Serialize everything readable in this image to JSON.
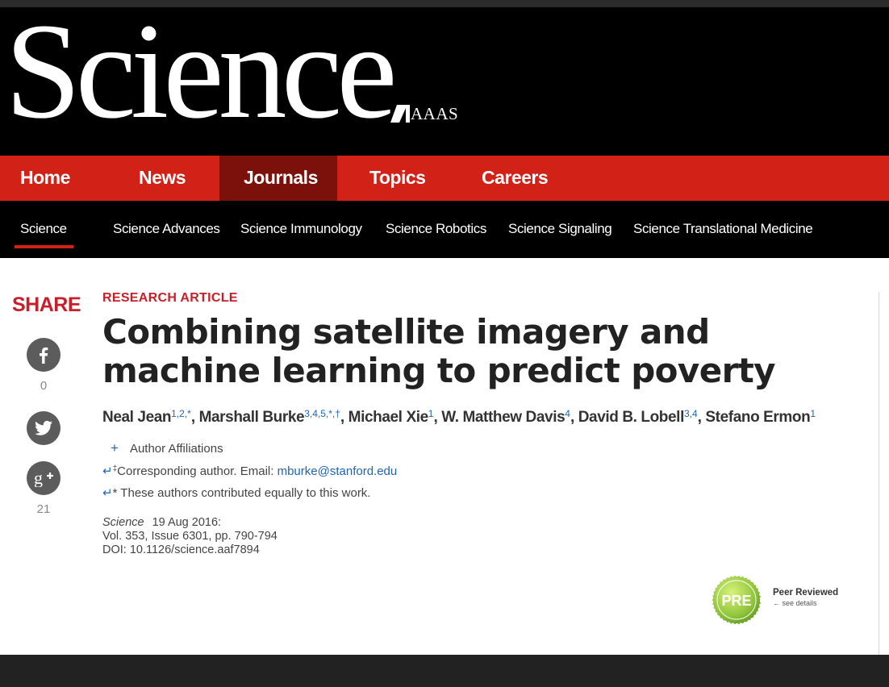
{
  "header": {
    "logo_text": "Science",
    "publisher": "AAAS"
  },
  "main_nav": [
    {
      "label": "Home",
      "active": false
    },
    {
      "label": "News",
      "active": false
    },
    {
      "label": "Journals",
      "active": true
    },
    {
      "label": "Topics",
      "active": false
    },
    {
      "label": "Careers",
      "active": false
    }
  ],
  "sub_nav": [
    {
      "label": "Science",
      "active": true
    },
    {
      "label": "Science Advances"
    },
    {
      "label": "Science Immunology"
    },
    {
      "label": "Science Robotics"
    },
    {
      "label": "Science Signaling"
    },
    {
      "label": "Science Translational Medicine"
    }
  ],
  "share": {
    "title": "SHARE",
    "facebook_count": "0",
    "twitter_count": "",
    "google_count": "21",
    "icons": [
      "facebook-icon",
      "twitter-icon",
      "google-plus-icon"
    ]
  },
  "article": {
    "kicker": "RESEARCH ARTICLE",
    "title": "Combining satellite imagery and machine learning to predict poverty",
    "authors": [
      {
        "name": "Neal Jean",
        "marks": "1,2,*"
      },
      {
        "name": "Marshall Burke",
        "marks": "3,4,5,*,†"
      },
      {
        "name": "Michael Xie",
        "marks": "1"
      },
      {
        "name": "W. Matthew Davis",
        "marks": "4"
      },
      {
        "name": "David B. Lobell",
        "marks": "3,4"
      },
      {
        "name": "Stefano Ermon",
        "marks": "1"
      }
    ],
    "author_affiliations_toggle": "+",
    "author_affiliations_label": "Author Affiliations",
    "return_arrow": "↵",
    "corresponding_mark": "‡",
    "corresponding_text": "Corresponding author. Email: ",
    "corresponding_email": "mburke@stanford.edu",
    "equal_contrib_text": "* These authors contributed equally to this work.",
    "journal": "Science",
    "date": "19 Aug 2016:",
    "volume": "Vol. 353, Issue 6301, pp. 790-794",
    "doi": "DOI: 10.1126/science.aaf7894"
  },
  "badge": {
    "logo_text": "PRE",
    "title": "Peer Reviewed",
    "subtitle": "← see details"
  },
  "colors": {
    "brand_red": "#d22218",
    "active_nav": "#7b110a",
    "link_blue": "#2164b5",
    "masthead": "#000000"
  }
}
